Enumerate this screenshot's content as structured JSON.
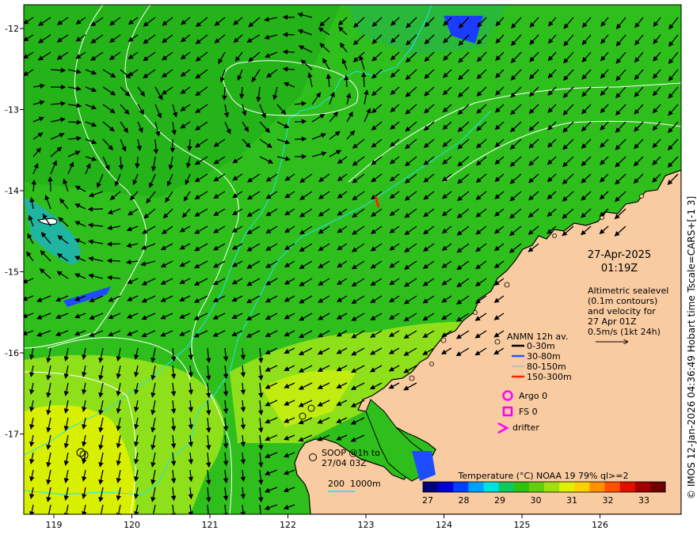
{
  "map": {
    "lon_ticks": [
      "119",
      "120",
      "121",
      "122",
      "123",
      "124",
      "125",
      "126"
    ],
    "lat_ticks": [
      "-12",
      "-13",
      "-14",
      "-15",
      "-16",
      "-17"
    ],
    "date": "27-Apr-2025",
    "time": "01:19Z",
    "description_lines": [
      "Altimetric sealevel",
      "(0.1m contours)",
      "and velocity for",
      "27 Apr 01Z",
      "0.5m/s (1kt 24h)"
    ],
    "anmn": {
      "title": "ANMN 12h av.",
      "items": [
        {
          "label": "0-30m",
          "color": "#000000"
        },
        {
          "label": "30-80m",
          "color": "#1f5cff"
        },
        {
          "label": "80-150m",
          "color": "#c0c0c0"
        },
        {
          "label": "150-300m",
          "color": "#ff2200"
        }
      ]
    },
    "argo_label": "Argo 0",
    "fs_label": "FS 0",
    "drifter_label": "drifter",
    "soop_lines": [
      "SOOP @1h to",
      "27/04 03Z"
    ],
    "depth_legend": {
      "a": "200",
      "b": "1000m"
    },
    "colorbar": {
      "title": "Temperature (°C) NOAA 19 79% ql>=2",
      "ticks": [
        "27",
        "28",
        "29",
        "30",
        "31",
        "32",
        "33"
      ],
      "colors": [
        "#00007f",
        "#0000d0",
        "#0040ff",
        "#00a0ff",
        "#00e0e0",
        "#10c860",
        "#30c010",
        "#60d010",
        "#a0e010",
        "#e0f000",
        "#ffd000",
        "#ff9000",
        "#ff5000",
        "#e01000",
        "#a00000",
        "#700000"
      ]
    },
    "credit": "© IMOS 12-Jan-2026 04:36:49 Hobart time Tscale=CARS+[-1 3]",
    "colors": {
      "land": "#f9cba0",
      "ocean": "#2fbf1c",
      "warm": "#d8f000",
      "coast": "#000000",
      "isobath": "#22e0f0",
      "contour": "#ffffff",
      "marker": "#ff00ff"
    }
  }
}
